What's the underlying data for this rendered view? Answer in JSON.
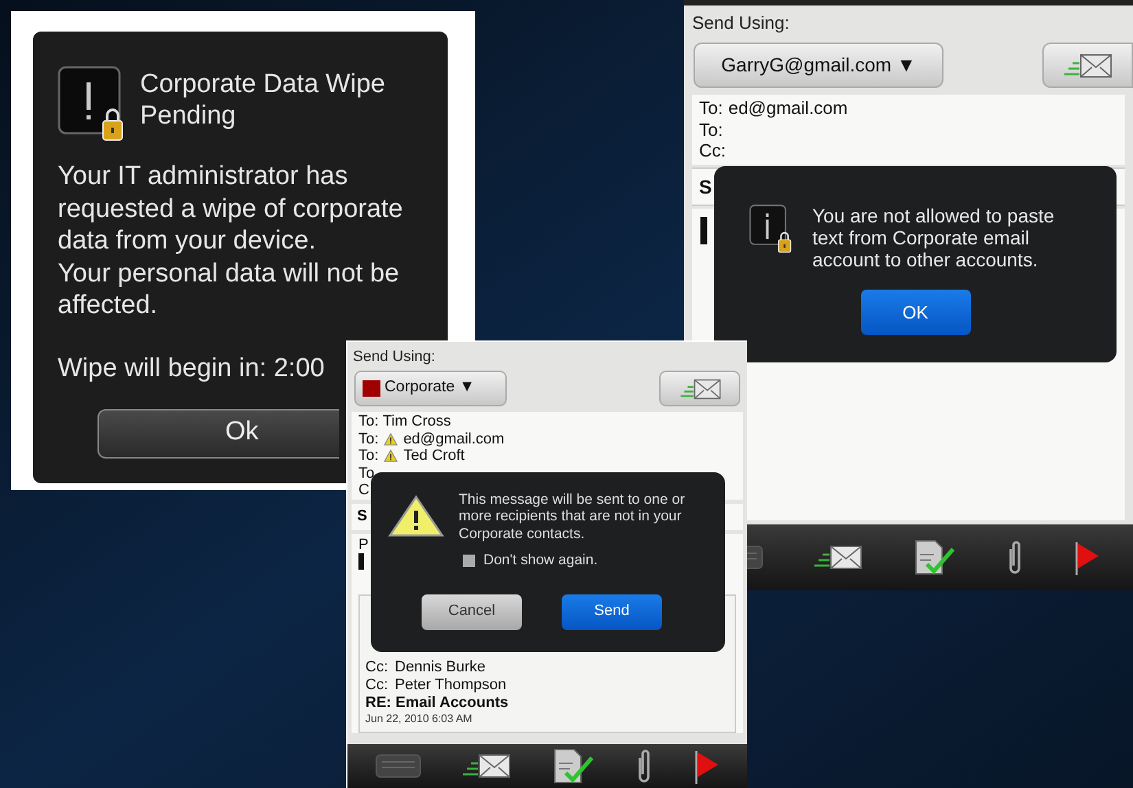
{
  "wipe_alert": {
    "title": "Corporate Data Wipe Pending",
    "message": "Your IT administrator has requested a wipe of corporate data from your device.",
    "note": "Your personal data will not be affected.",
    "countdown": "Wipe will begin in: 2:00",
    "button": "Ok"
  },
  "paste_screen": {
    "send_using_label": "Send Using:",
    "account": "GarryG@gmail.com ▼",
    "recipients": [
      {
        "label": "To:",
        "value": "ed@gmail.com"
      },
      {
        "label": "To:"
      },
      {
        "label": "Cc:"
      }
    ],
    "subject_fragment": "S",
    "dialog": {
      "message": "You are not allowed to paste text from Corporate email account to other accounts.",
      "button": "OK"
    }
  },
  "warning_screen": {
    "send_using_label": "Send Using:",
    "account": "Corporate ▼",
    "recipients": [
      {
        "label": "To:",
        "value": "Tim Cross",
        "warning": false
      },
      {
        "label": "To:",
        "value": "ed@gmail.com",
        "warning": true
      },
      {
        "label": "To:",
        "value": "Ted Croft",
        "warning": true
      },
      {
        "label": "To",
        "warning": false
      },
      {
        "label": "C",
        "warning": false
      }
    ],
    "subject_fragment": "S",
    "body_fragment": "P",
    "quoted": [
      {
        "label": "Cc:",
        "value": "Dennis Burke"
      },
      {
        "label": "Cc:",
        "value": "Peter Thompson"
      }
    ],
    "quoted_subject": "RE: Email Accounts",
    "quoted_date": "Jun 22, 2010 6:03 AM",
    "dialog": {
      "message": "This message will be sent to one or more recipients that are not in your Corporate contacts.",
      "checkbox": {
        "label": "Don't show again.",
        "checked": false
      },
      "buttons": [
        {
          "label": "Cancel",
          "kind": "secondary"
        },
        {
          "label": "Send",
          "kind": "primary"
        }
      ]
    }
  }
}
